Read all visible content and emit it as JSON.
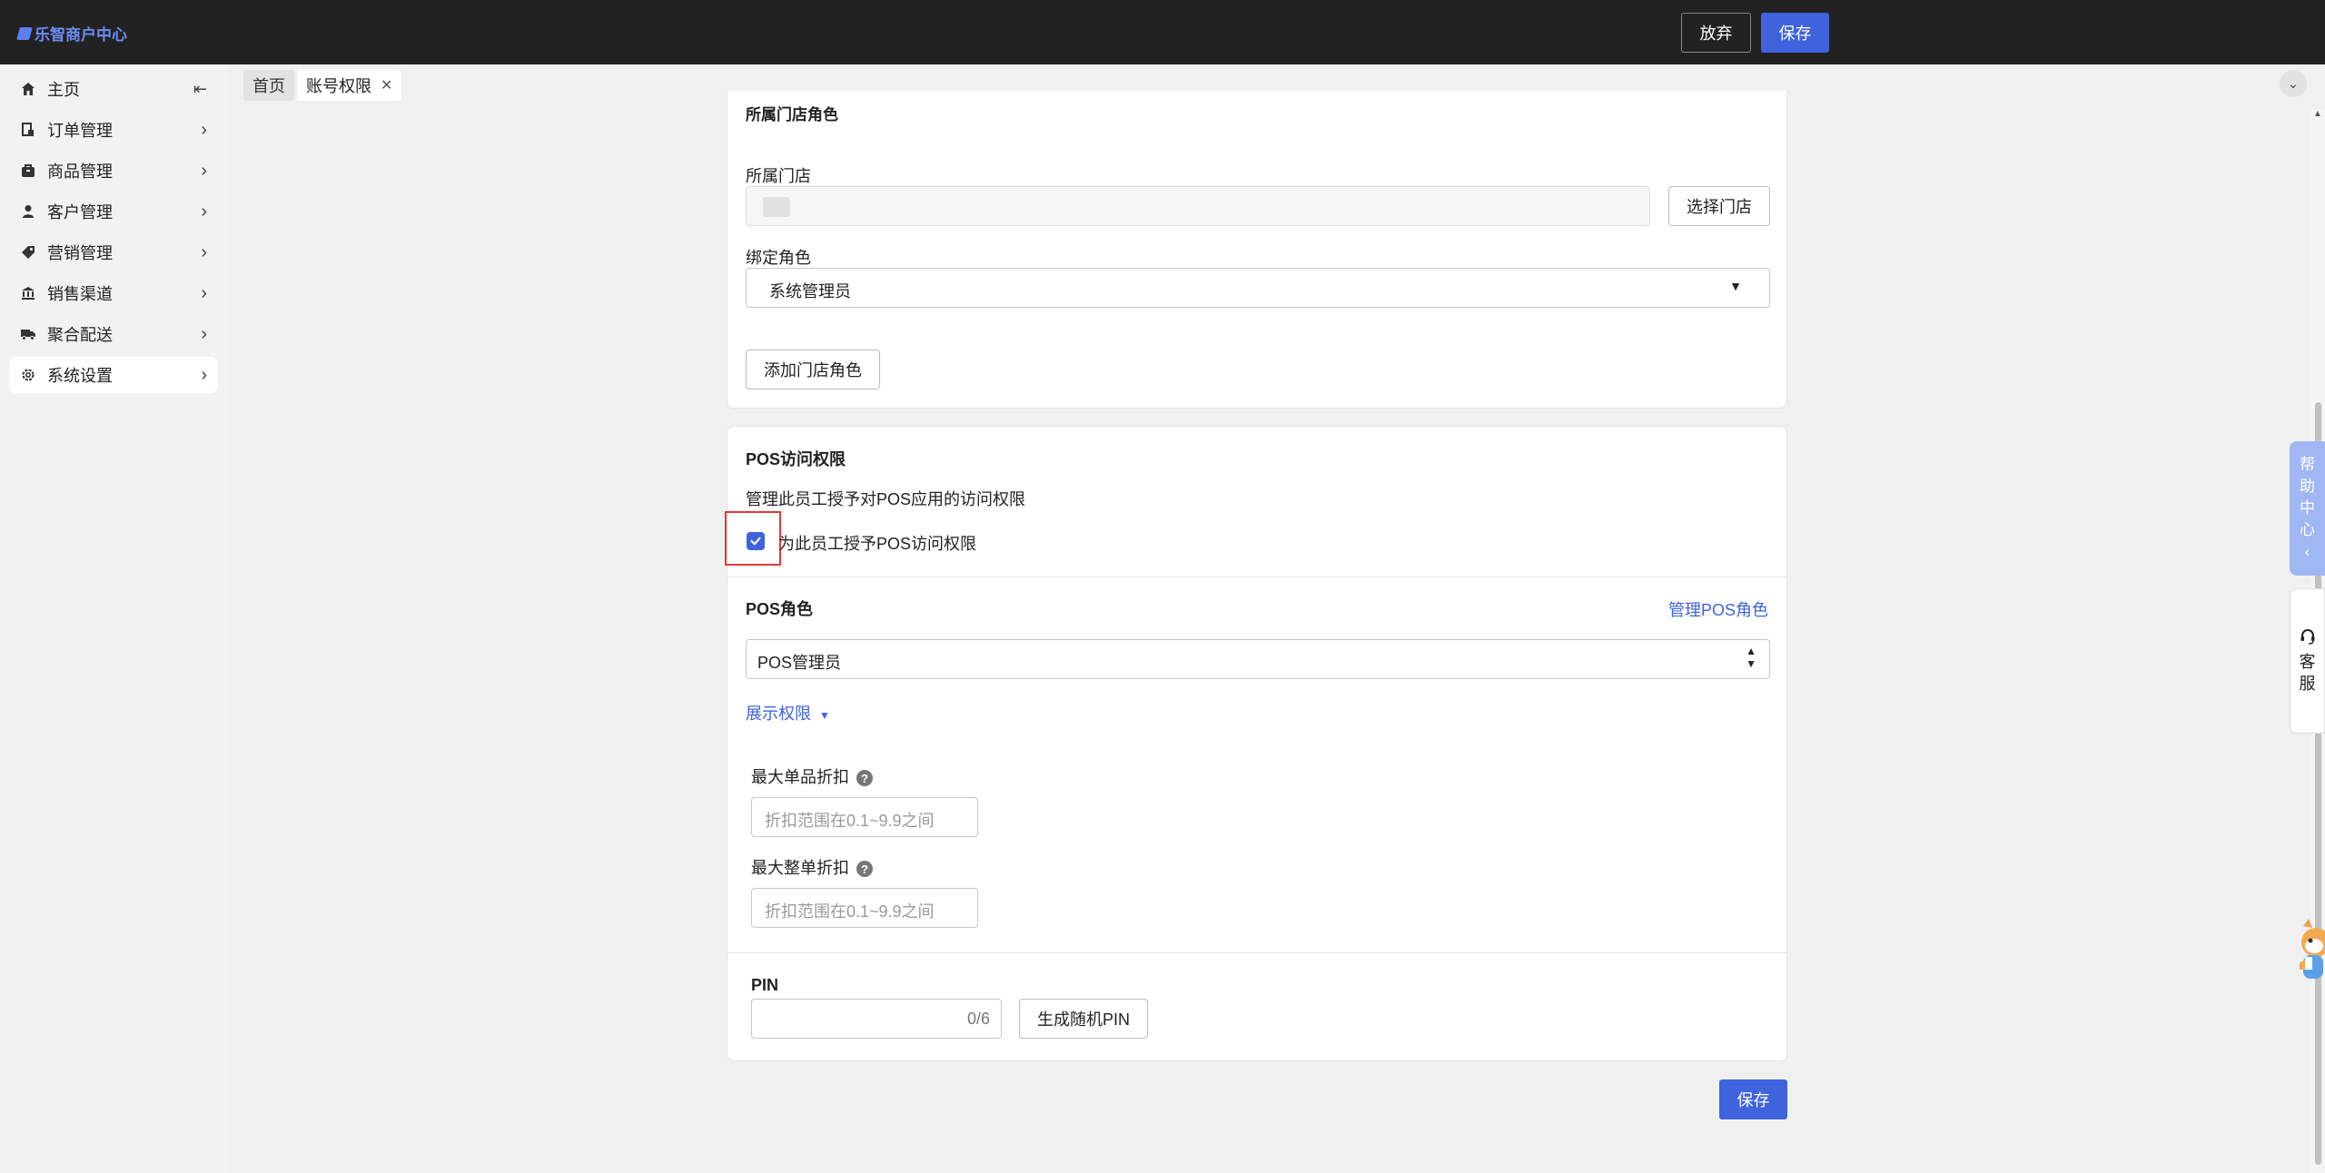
{
  "app": {
    "title": "乐智商户中心"
  },
  "header": {
    "discard_label": "放弃",
    "save_label": "保存"
  },
  "sidebar": {
    "collapse_icon": "collapse-icon",
    "items": [
      {
        "label": "主页",
        "icon": "home-icon"
      },
      {
        "label": "订单管理",
        "icon": "order-icon"
      },
      {
        "label": "商品管理",
        "icon": "product-icon"
      },
      {
        "label": "客户管理",
        "icon": "customer-icon"
      },
      {
        "label": "营销管理",
        "icon": "tag-icon"
      },
      {
        "label": "销售渠道",
        "icon": "bank-icon"
      },
      {
        "label": "聚合配送",
        "icon": "delivery-icon"
      },
      {
        "label": "系统设置",
        "icon": "gear-icon",
        "active": true
      }
    ]
  },
  "tabs": [
    {
      "label": "首页"
    },
    {
      "label": "账号权限",
      "closable": true
    }
  ],
  "store_section": {
    "title": "所属门店角色",
    "store_label": "所属门店",
    "select_store_button": "选择门店",
    "role_label": "绑定角色",
    "role_value": "系统管理员",
    "add_role_button": "添加门店角色"
  },
  "pos_section": {
    "title": "POS访问权限",
    "description": "管理此员工授予对POS应用的访问权限",
    "grant_checkbox_label": "为此员工授予POS访问权限",
    "grant_checked": true,
    "role_title": "POS角色",
    "manage_roles_link": "管理POS角色",
    "role_value": "POS管理员",
    "show_permissions_link": "展示权限",
    "max_item_discount_label": "最大单品折扣",
    "max_item_discount_placeholder": "折扣范围在0.1~9.9之间",
    "max_order_discount_label": "最大整单折扣",
    "max_order_discount_placeholder": "折扣范围在0.1~9.9之间",
    "pin_label": "PIN",
    "pin_counter": "0/6",
    "generate_pin_button": "生成随机PIN"
  },
  "footer": {
    "save_label": "保存"
  },
  "floating": {
    "help_center": [
      "帮",
      "助",
      "中",
      "心",
      "‹"
    ],
    "customer_service": [
      "客",
      "服"
    ]
  },
  "colors": {
    "accent": "#3e63dd",
    "highlight_box": "#e53935",
    "link": "#3e63dd"
  }
}
